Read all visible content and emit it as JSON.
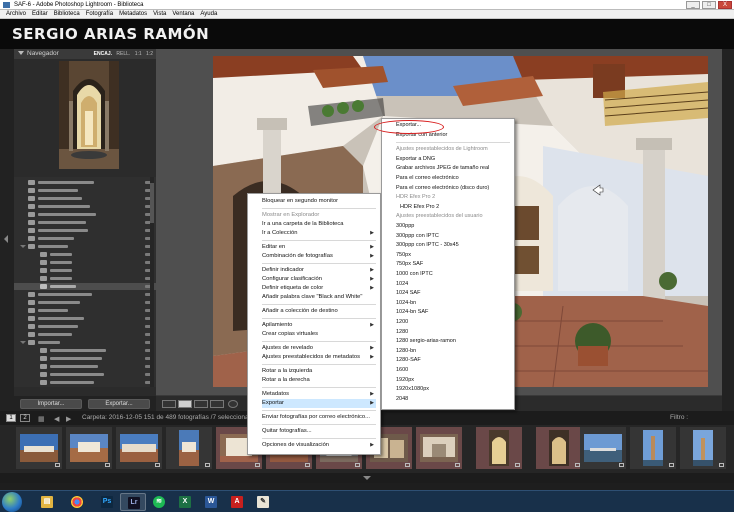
{
  "window": {
    "title": "SAF-6 - Adobe Photoshop Lightroom - Biblioteca",
    "buttons": [
      "_",
      "□",
      "X"
    ]
  },
  "menubar": [
    "Archivo",
    "Editar",
    "Biblioteca",
    "Fotografía",
    "Metadatos",
    "Vista",
    "Ventana",
    "Ayuda"
  ],
  "identity_plate": "SERGIO ARIAS RAMÓN",
  "navigator": {
    "title": "Navegador",
    "zoom_options": [
      "ENCAJ.",
      "RELL.",
      "1:1",
      "1:2"
    ],
    "selected_zoom": "ENCAJ."
  },
  "left_buttons": {
    "import": "Importar...",
    "export": "Exportar..."
  },
  "filmstrip_header": {
    "screens": [
      "1",
      "2"
    ],
    "path": "Carpeta: 2016-12-05    151 de 489 fotografías /7 seleccionad(s)",
    "filter_label": "Filtro :"
  },
  "context_menu": {
    "items": [
      {
        "label": "Bloquear en segundo monitor",
        "enabled": true,
        "submenu": false
      },
      {
        "separator": true
      },
      {
        "label": "Mostrar en Explorador",
        "enabled": false,
        "submenu": false
      },
      {
        "label": "Ir a una carpeta de la Biblioteca",
        "enabled": true,
        "submenu": false
      },
      {
        "label": "Ir a Colección",
        "enabled": true,
        "submenu": true
      },
      {
        "separator": true
      },
      {
        "label": "Editar en",
        "enabled": true,
        "submenu": true
      },
      {
        "label": "Combinación de fotografías",
        "enabled": true,
        "submenu": true
      },
      {
        "separator": true
      },
      {
        "label": "Definir indicador",
        "enabled": true,
        "submenu": true
      },
      {
        "label": "Configurar clasificación",
        "enabled": true,
        "submenu": true
      },
      {
        "label": "Definir etiqueta de color",
        "enabled": true,
        "submenu": true
      },
      {
        "label": "Añadir palabra clave \"Black and White\"",
        "enabled": true,
        "submenu": false
      },
      {
        "separator": true
      },
      {
        "label": "Añadir a colección de destino",
        "enabled": true,
        "submenu": false
      },
      {
        "separator": true
      },
      {
        "label": "Apilamiento",
        "enabled": true,
        "submenu": true
      },
      {
        "label": "Crear copias virtuales",
        "enabled": true,
        "submenu": false
      },
      {
        "separator": true
      },
      {
        "label": "Ajustes de revelado",
        "enabled": true,
        "submenu": true
      },
      {
        "label": "Ajustes preestablecidos de metadatos",
        "enabled": true,
        "submenu": true
      },
      {
        "separator": true
      },
      {
        "label": "Rotar a la izquierda",
        "enabled": true,
        "submenu": false
      },
      {
        "label": "Rotar a la derecha",
        "enabled": true,
        "submenu": false
      },
      {
        "separator": true
      },
      {
        "label": "Metadatos",
        "enabled": true,
        "submenu": true
      },
      {
        "label": "Exportar",
        "enabled": true,
        "submenu": true,
        "highlighted": true
      },
      {
        "separator": true
      },
      {
        "label": "Enviar fotografías por correo electrónico...",
        "enabled": true,
        "submenu": false
      },
      {
        "separator": true
      },
      {
        "label": "Quitar fotografías...",
        "enabled": true,
        "submenu": false
      },
      {
        "separator": true
      },
      {
        "label": "Opciones de visualización",
        "enabled": true,
        "submenu": true
      }
    ]
  },
  "export_submenu": {
    "items": [
      {
        "label": "Exportar...",
        "type": "item",
        "circled": true
      },
      {
        "label": "Exportar con anterior",
        "type": "item"
      },
      {
        "separator": true
      },
      {
        "label": "Ajustes preestablecidos de Lightroom",
        "type": "header"
      },
      {
        "label": "Exportar a DNG",
        "type": "item"
      },
      {
        "label": "Grabar archivos JPEG de tamaño real",
        "type": "item"
      },
      {
        "label": "Para el correo electrónico",
        "type": "item"
      },
      {
        "label": "Para el correo electrónico (disco duro)",
        "type": "item"
      },
      {
        "label": "HDR Efex Pro 2",
        "type": "header"
      },
      {
        "label": "HDR Efex Pro 2",
        "type": "indent"
      },
      {
        "label": "Ajustes preestablecidos del usuario",
        "type": "header"
      },
      {
        "label": "300ppp",
        "type": "item"
      },
      {
        "label": "300ppp con IPTC",
        "type": "item"
      },
      {
        "label": "300ppp con IPTC - 30x45",
        "type": "item"
      },
      {
        "label": "750px",
        "type": "item"
      },
      {
        "label": "750px SAF",
        "type": "item"
      },
      {
        "label": "1000 con IPTC",
        "type": "item"
      },
      {
        "label": "1024",
        "type": "item"
      },
      {
        "label": "1024 SAF",
        "type": "item"
      },
      {
        "label": "1024-bn",
        "type": "item"
      },
      {
        "label": "1024-bn SAF",
        "type": "item"
      },
      {
        "label": "1200",
        "type": "item"
      },
      {
        "label": "1280",
        "type": "item"
      },
      {
        "label": "1280 sergio-arias-ramon",
        "type": "item"
      },
      {
        "label": "1280-bn",
        "type": "item"
      },
      {
        "label": "1280-SAF",
        "type": "item"
      },
      {
        "label": "1600",
        "type": "item"
      },
      {
        "label": "1920px",
        "type": "item"
      },
      {
        "label": "1920x1080px",
        "type": "item"
      },
      {
        "label": "2048",
        "type": "item"
      }
    ]
  },
  "taskbar": {
    "apps": [
      "start-button",
      "explorer",
      "chrome",
      "photoshop",
      "lightroom",
      "spotify",
      "excel",
      "word",
      "acrobat",
      "paint"
    ]
  },
  "colors": {
    "background": "#1e1e1e",
    "panel": "#2b2b2b",
    "main_bg": "#4f4f4f",
    "highlight": "#cde8ff",
    "annotation": "#d81d1d",
    "taskbar": "#18304a"
  }
}
